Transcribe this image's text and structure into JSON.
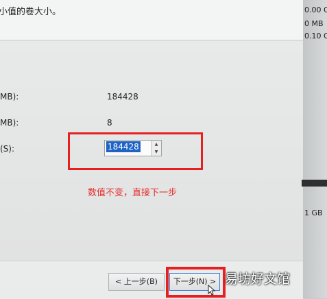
{
  "header": {
    "instruction": "小值的卷大小。"
  },
  "fields": [
    {
      "label": "MB):",
      "value": "184428"
    },
    {
      "label": "MB):",
      "value": "8"
    },
    {
      "label": "(S):",
      "value": "184428"
    }
  ],
  "spinner": {
    "up_glyph": "▲",
    "down_glyph": "▼"
  },
  "annotation": {
    "text": "数值不变，直接下一步",
    "color": "#e52b2b"
  },
  "buttons": {
    "back": "< 上一步(B)",
    "next": "下一步(N) >"
  },
  "right_panel": {
    "line1": "0.00 G",
    "line2": "0 MB",
    "line3": "0.10 G",
    "line4": "1 GB"
  },
  "watermark": {
    "text": "易坊好文馆"
  },
  "icons": {
    "cursor": "mouse-cursor-icon"
  }
}
